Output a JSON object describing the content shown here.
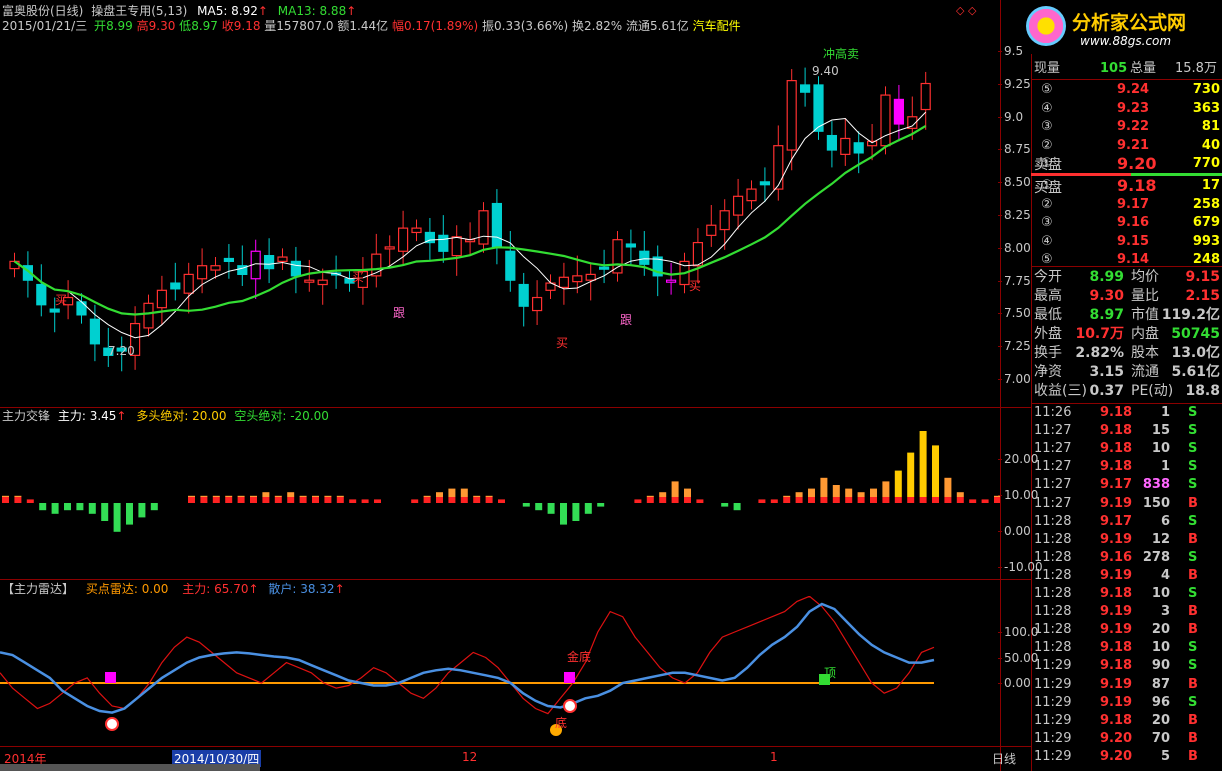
{
  "colors": {
    "up": "#ff3030",
    "down": "#00d0d0",
    "pink": "#ff00ff",
    "ma5": "#ffffff",
    "ma13": "#33dd33",
    "grid": "#8b0000",
    "yellow": "#ffff00",
    "blue": "#4a90e2",
    "orange": "#ff9900"
  },
  "header": {
    "name": "富奥股份(日线)",
    "tool": "操盘王专用(5,13)",
    "ma5": "MA5: 8.92",
    "ma13": "MA13: 8.88",
    "date": "2015/01/21/三",
    "open_label": "开",
    "open": "8.99",
    "high_label": "高",
    "high": "9.30",
    "low_label": "低",
    "low": "8.97",
    "close_label": "收",
    "close": "9.18",
    "volume": "量157807.0",
    "amount": "额1.44亿",
    "change": "幅0.17(1.89%)",
    "amplitude": "振0.33(3.66%)",
    "turnover": "换2.82%",
    "float": "流通5.61亿",
    "sector": "汽车配件"
  },
  "logo": {
    "text": "分析家公式网",
    "url": "www.88gs.com"
  },
  "main_chart": {
    "y_ticks": [
      "9.5",
      "9.25",
      "9.0",
      "8.75",
      "8.50",
      "8.25",
      "8.00",
      "7.75",
      "7.50",
      "7.25",
      "7.00"
    ],
    "annotations": {
      "high_label": "冲高卖",
      "high_price": "9.40",
      "low_price": "7.20"
    },
    "signals": [
      "买",
      "跟",
      "买",
      "跟",
      "买",
      "买"
    ]
  },
  "indicator1": {
    "title": "主力交锋",
    "main": "主力: 3.45",
    "bull": "多头绝对: 20.00",
    "bear": "空头绝对: -20.00",
    "y_ticks": [
      "20.00",
      "10.00",
      "0.00",
      "-10.00"
    ]
  },
  "indicator2": {
    "title": "【主力雷达】",
    "buy": "买点雷达: 0.00",
    "main": "主力: 65.70",
    "retail": "散户: 38.32",
    "y_ticks": [
      "100.0",
      "50.00",
      "0.00"
    ],
    "labels": {
      "jin_di": "金底",
      "ding": "顶",
      "di": "底"
    }
  },
  "x_axis": {
    "labels": [
      "2014年",
      "2014/10/30/四",
      "12",
      "1"
    ],
    "period": "日线"
  },
  "side_panel": {
    "top": {
      "cur_vol_label": "现量",
      "cur_vol": "105",
      "tot_vol_label": "总量",
      "tot_vol": "15.8万"
    },
    "sell_label": "卖盘",
    "sell": [
      {
        "n": "⑤",
        "p": "9.24",
        "v": "730"
      },
      {
        "n": "④",
        "p": "9.23",
        "v": "363"
      },
      {
        "n": "③",
        "p": "9.22",
        "v": "81"
      },
      {
        "n": "②",
        "p": "9.21",
        "v": "40"
      },
      {
        "n": "①",
        "p": "9.20",
        "v": "770"
      }
    ],
    "buy_label": "买盘",
    "buy": [
      {
        "n": "①",
        "p": "9.18",
        "v": "17"
      },
      {
        "n": "②",
        "p": "9.17",
        "v": "258"
      },
      {
        "n": "③",
        "p": "9.16",
        "v": "679"
      },
      {
        "n": "④",
        "p": "9.15",
        "v": "993"
      },
      {
        "n": "⑤",
        "p": "9.14",
        "v": "248"
      }
    ],
    "stats": [
      {
        "l1": "今开",
        "v1": "8.99",
        "c1": "#33dd33",
        "l2": "均价",
        "v2": "9.15",
        "c2": "#ff3030"
      },
      {
        "l1": "最高",
        "v1": "9.30",
        "c1": "#ff3030",
        "l2": "量比",
        "v2": "2.15",
        "c2": "#ff3030"
      },
      {
        "l1": "最低",
        "v1": "8.97",
        "c1": "#33dd33",
        "l2": "市值",
        "v2": "119.2亿",
        "c2": "#c8c8c8"
      },
      {
        "l1": "外盘",
        "v1": "10.7万",
        "c1": "#ff3030",
        "l2": "内盘",
        "v2": "50745",
        "c2": "#33dd33"
      },
      {
        "l1": "换手",
        "v1": "2.82%",
        "c1": "#c8c8c8",
        "l2": "股本",
        "v2": "13.0亿",
        "c2": "#c8c8c8"
      },
      {
        "l1": "净资",
        "v1": "3.15",
        "c1": "#c8c8c8",
        "l2": "流通",
        "v2": "5.61亿",
        "c2": "#c8c8c8"
      },
      {
        "l1": "收益(三)",
        "v1": "0.37",
        "c1": "#c8c8c8",
        "l2": "PE(动)",
        "v2": "18.8",
        "c2": "#c8c8c8"
      }
    ],
    "ticks": [
      {
        "t": "11:26",
        "p": "9.18",
        "v": "1",
        "s": "S"
      },
      {
        "t": "11:27",
        "p": "9.18",
        "v": "15",
        "s": "S"
      },
      {
        "t": "11:27",
        "p": "9.18",
        "v": "10",
        "s": "S"
      },
      {
        "t": "11:27",
        "p": "9.18",
        "v": "1",
        "s": "S"
      },
      {
        "t": "11:27",
        "p": "9.17",
        "v": "838",
        "s": "S"
      },
      {
        "t": "11:27",
        "p": "9.19",
        "v": "150",
        "s": "B"
      },
      {
        "t": "11:28",
        "p": "9.17",
        "v": "6",
        "s": "S"
      },
      {
        "t": "11:28",
        "p": "9.19",
        "v": "12",
        "s": "B"
      },
      {
        "t": "11:28",
        "p": "9.16",
        "v": "278",
        "s": "S"
      },
      {
        "t": "11:28",
        "p": "9.19",
        "v": "4",
        "s": "B"
      },
      {
        "t": "11:28",
        "p": "9.18",
        "v": "10",
        "s": "S"
      },
      {
        "t": "11:28",
        "p": "9.19",
        "v": "3",
        "s": "B"
      },
      {
        "t": "11:28",
        "p": "9.19",
        "v": "20",
        "s": "B"
      },
      {
        "t": "11:28",
        "p": "9.18",
        "v": "10",
        "s": "S"
      },
      {
        "t": "11:29",
        "p": "9.18",
        "v": "90",
        "s": "S"
      },
      {
        "t": "11:29",
        "p": "9.19",
        "v": "87",
        "s": "B"
      },
      {
        "t": "11:29",
        "p": "9.19",
        "v": "96",
        "s": "S"
      },
      {
        "t": "11:29",
        "p": "9.18",
        "v": "20",
        "s": "B"
      },
      {
        "t": "11:29",
        "p": "9.20",
        "v": "70",
        "s": "B"
      },
      {
        "t": "11:29",
        "p": "9.20",
        "v": "5",
        "s": "B"
      }
    ]
  }
}
